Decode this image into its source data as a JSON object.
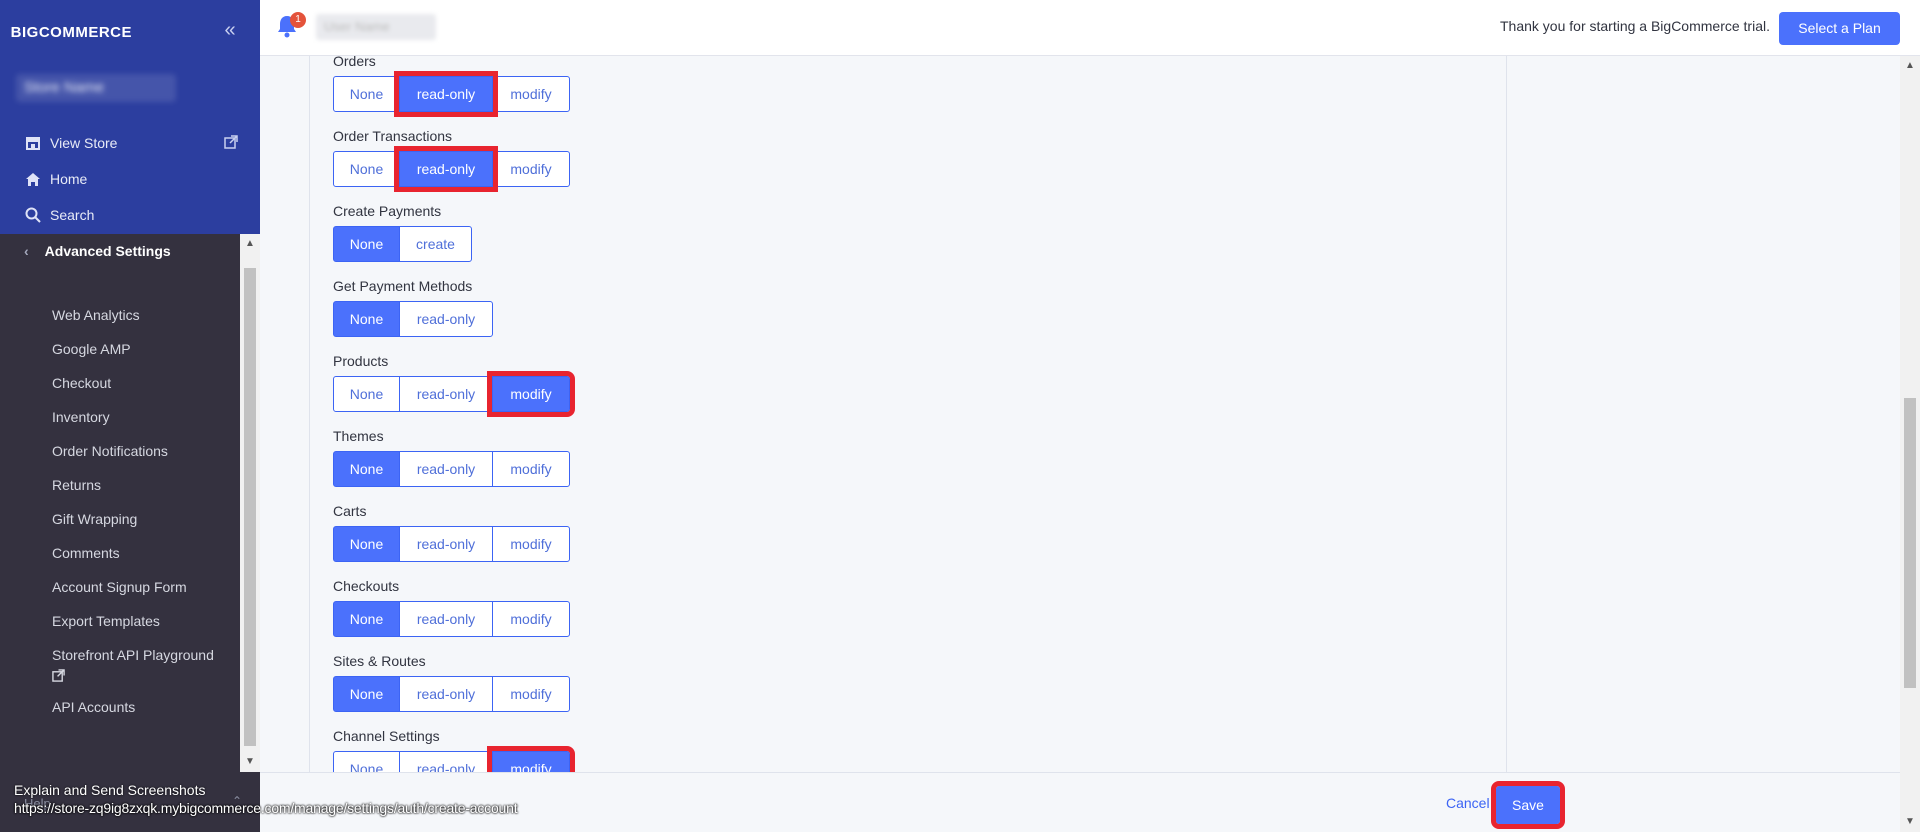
{
  "brand": {
    "logo_text": "BIGCOMMERCE",
    "accent": "#4b71fc",
    "sidebar_top_color": "#2c3e9f",
    "sidebar_color": "#34313f"
  },
  "sidebar": {
    "store_name": "Store Name",
    "links": [
      {
        "label": "View Store",
        "icon": "storefront-icon"
      },
      {
        "label": "Home",
        "icon": "home-icon"
      },
      {
        "label": "Search",
        "icon": "search-icon"
      }
    ],
    "section_title": "Advanced Settings",
    "items": [
      "Web Analytics",
      "Google AMP",
      "Checkout",
      "Inventory",
      "Order Notifications",
      "Returns",
      "Gift Wrapping",
      "Comments",
      "Account Signup Form",
      "Export Templates",
      "Storefront API Playground",
      "API Accounts"
    ],
    "help_label": "Help"
  },
  "topbar": {
    "notification_count": "1",
    "user_name": "User Name",
    "trial_text": "Thank you for starting a BigCommerce trial.",
    "select_plan_label": "Select a Plan"
  },
  "permissions": [
    {
      "label": "Orders",
      "options": [
        "None",
        "read-only",
        "modify"
      ],
      "selected": "read-only"
    },
    {
      "label": "Order Transactions",
      "options": [
        "None",
        "read-only",
        "modify"
      ],
      "selected": "read-only"
    },
    {
      "label": "Create Payments",
      "options": [
        "None",
        "create"
      ],
      "selected": "None"
    },
    {
      "label": "Get Payment Methods",
      "options": [
        "None",
        "read-only"
      ],
      "selected": "None"
    },
    {
      "label": "Products",
      "options": [
        "None",
        "read-only",
        "modify"
      ],
      "selected": "modify"
    },
    {
      "label": "Themes",
      "options": [
        "None",
        "read-only",
        "modify"
      ],
      "selected": "None"
    },
    {
      "label": "Carts",
      "options": [
        "None",
        "read-only",
        "modify"
      ],
      "selected": "None"
    },
    {
      "label": "Checkouts",
      "options": [
        "None",
        "read-only",
        "modify"
      ],
      "selected": "None"
    },
    {
      "label": "Sites & Routes",
      "options": [
        "None",
        "read-only",
        "modify"
      ],
      "selected": "None"
    },
    {
      "label": "Channel Settings",
      "options": [
        "None",
        "read-only",
        "modify"
      ],
      "selected": "modify"
    }
  ],
  "footer": {
    "cancel_label": "Cancel",
    "save_label": "Save"
  },
  "overlay": {
    "line1": "Explain and Send Screenshots",
    "line2": "https://store-zq9ig8zxqk.mybigcommerce.com/manage/settings/auth/create-account"
  }
}
